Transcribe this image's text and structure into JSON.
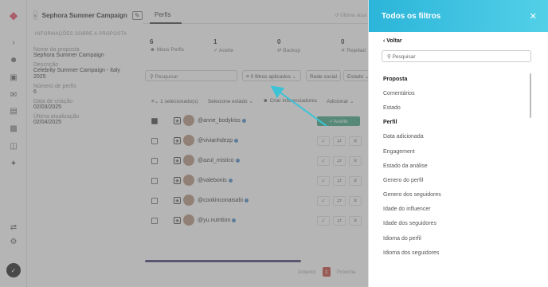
{
  "campaign": {
    "title": "Sephora Summer Campaign",
    "section": "INFORMAÇÕES SOBRE A PROPOSTA",
    "fields": [
      {
        "label": "Nome da proposta",
        "value": "Sephora Summer Campaign"
      },
      {
        "label": "Descrição",
        "value": "Celebrity Summer Campaign - Italy 2025"
      },
      {
        "label": "Número de perfis",
        "value": "6"
      },
      {
        "label": "Data de criação",
        "value": "02/03/2025"
      },
      {
        "label": "Última atualização",
        "value": "02/04/2025"
      }
    ]
  },
  "tabs": {
    "active": "Perfis",
    "last_update": "Última atua"
  },
  "stats": [
    {
      "num": "6",
      "label": "Meus Perfis"
    },
    {
      "num": "1",
      "label": "Aceite"
    },
    {
      "num": "0",
      "label": "Backup"
    },
    {
      "num": "0",
      "label": "Rejeitad"
    }
  ],
  "toolbar": {
    "search_placeholder": "Pesquisar",
    "filters_applied": "0 filtros aplicados",
    "social_network": "Rede social",
    "state": "Estado"
  },
  "bulk": {
    "selected": "1 selecionado(s)",
    "select_state": "Selecione estado",
    "create_influencers": "Criar influenciadores",
    "add": "Adicionar"
  },
  "rows": [
    {
      "handle": "@anne_bodykiss",
      "checked": true,
      "status": "Aceite"
    },
    {
      "handle": "@vivianhdezp",
      "checked": false,
      "status": ""
    },
    {
      "handle": "@azul_mistico",
      "checked": false,
      "status": ""
    },
    {
      "handle": "@valebonis",
      "checked": false,
      "status": ""
    },
    {
      "handle": "@cookinconaisabi",
      "checked": false,
      "status": ""
    },
    {
      "handle": "@yu.nutrition",
      "checked": false,
      "status": ""
    }
  ],
  "pager": {
    "prev": "Anterior",
    "page": "1",
    "next": "Próxima"
  },
  "drawer": {
    "title": "Todos os filtros",
    "back": "Voltar",
    "search_placeholder": "Pesquisar",
    "items": [
      {
        "label": "Proposta",
        "header": true
      },
      {
        "label": "Comentários",
        "header": false
      },
      {
        "label": "Estado",
        "header": false
      },
      {
        "label": "Perfil",
        "header": true
      },
      {
        "label": "Data adicionada",
        "header": false
      },
      {
        "label": "Engagement",
        "header": false
      },
      {
        "label": "Estado da análise",
        "header": false
      },
      {
        "label": "Genero do perfil",
        "header": false
      },
      {
        "label": "Genero dos seguidores",
        "header": false
      },
      {
        "label": "Idade do influencer",
        "header": false
      },
      {
        "label": "Idade dos seguidores",
        "header": false
      },
      {
        "label": "Idioma do perfil",
        "header": false
      },
      {
        "label": "Idioma dos seguidores",
        "header": false
      }
    ]
  },
  "colors": {
    "drawer_header": "#2bb5d9",
    "accepted": "#2e9e76",
    "arrow": "#3ec3d6",
    "brand": "#e2334c"
  }
}
